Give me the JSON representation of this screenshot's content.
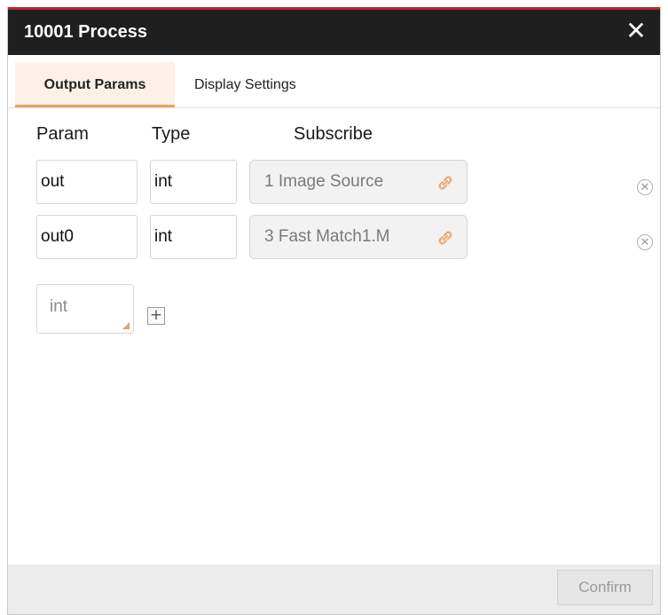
{
  "dialog": {
    "title": "10001 Process",
    "close_label": "✕"
  },
  "tabs": [
    {
      "label": "Output Params",
      "active": true
    },
    {
      "label": "Display Settings",
      "active": false
    }
  ],
  "columns": {
    "param": "Param",
    "type": "Type",
    "subscribe": "Subscribe"
  },
  "rows": [
    {
      "param": "out",
      "type": "int",
      "subscribe": "1 Image Source"
    },
    {
      "param": "out0",
      "type": "int",
      "subscribe": "3 Fast Match1.M"
    }
  ],
  "new_param": {
    "type_value": "int",
    "add_label": "+"
  },
  "footer": {
    "confirm_label": "Confirm"
  },
  "icons": {
    "subscribe": "link-icon",
    "delete": "delete-circle-icon",
    "add": "plus-icon"
  },
  "colors": {
    "titlebar": "#1f1f1f",
    "accent_top": "#b8282b",
    "tab_active_bg": "#fdf0e6",
    "tab_underline": "#f0a060",
    "link_icon": "#e8a878"
  }
}
